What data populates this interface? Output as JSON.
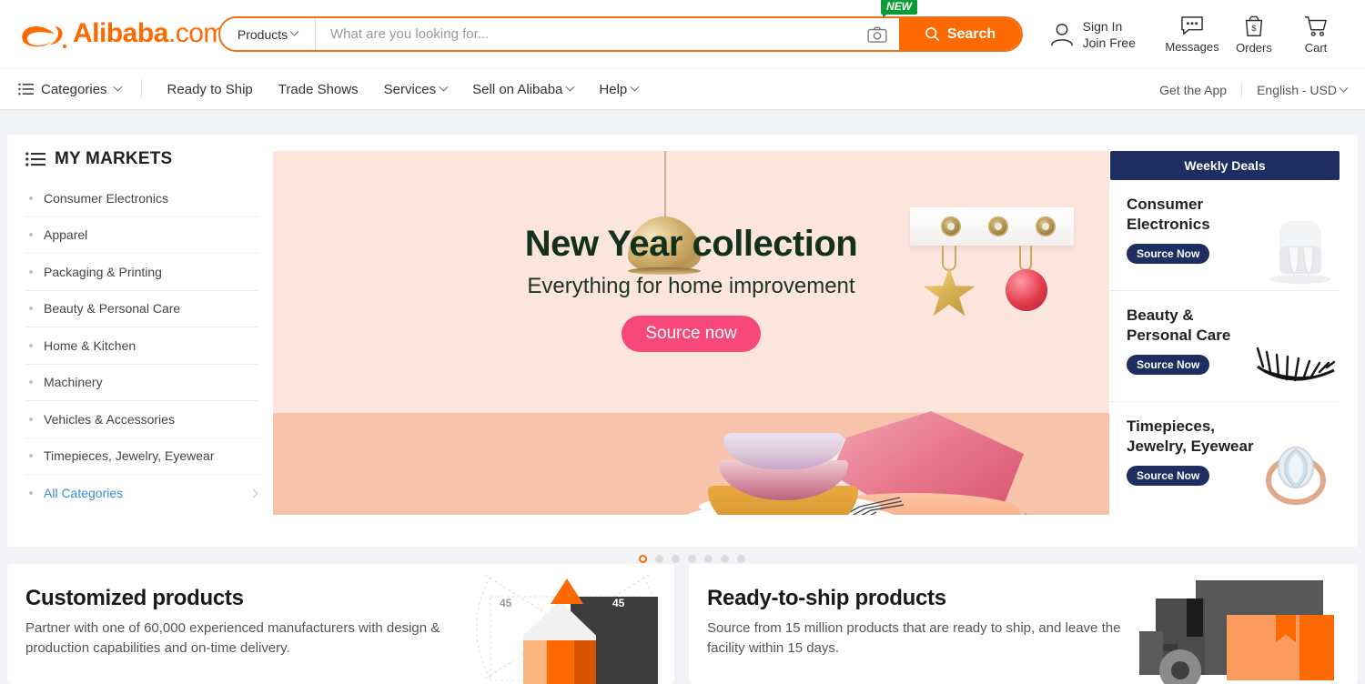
{
  "header": {
    "logo_text": "Alibaba",
    "logo_suffix": ".com",
    "search": {
      "category_label": "Products",
      "placeholder": "What are you looking for...",
      "value": "",
      "camera_badge": "NEW",
      "button_label": "Search"
    },
    "account": {
      "sign_in": "Sign In",
      "join_free": "Join Free"
    },
    "messages_label": "Messages",
    "orders_label": "Orders",
    "cart_label": "Cart"
  },
  "nav": {
    "categories_label": "Categories",
    "links": [
      {
        "label": "Ready to Ship",
        "caret": false
      },
      {
        "label": "Trade Shows",
        "caret": false
      },
      {
        "label": "Services",
        "caret": true
      },
      {
        "label": "Sell on Alibaba",
        "caret": true
      },
      {
        "label": "Help",
        "caret": true
      }
    ],
    "get_app": "Get the App",
    "locale": "English - USD"
  },
  "sidebar": {
    "title": "MY MARKETS",
    "items": [
      {
        "label": "Consumer Electronics"
      },
      {
        "label": "Apparel"
      },
      {
        "label": "Packaging & Printing"
      },
      {
        "label": "Beauty & Personal Care"
      },
      {
        "label": "Home & Kitchen"
      },
      {
        "label": "Machinery"
      },
      {
        "label": "Vehicles & Accessories"
      },
      {
        "label": "Timepieces, Jewelry, Eyewear"
      }
    ],
    "all_categories": "All Categories"
  },
  "hero": {
    "title": "New Year collection",
    "subtitle": "Everything for home improvement",
    "cta": "Source now",
    "slide_count": 7,
    "active_slide": 1
  },
  "deals": {
    "heading": "Weekly Deals",
    "items": [
      {
        "title": "Consumer Electronics",
        "button": "Source Now",
        "image": "earbuds-image"
      },
      {
        "title": "Beauty & Personal Care",
        "button": "Source Now",
        "image": "eyelashes-image"
      },
      {
        "title": "Timepieces, Jewelry, Eyewear",
        "button": "Source Now",
        "image": "diamond-ring-image"
      }
    ]
  },
  "promos": [
    {
      "title": "Customized products",
      "text": "Partner with one of 60,000 experienced manufacturers with design & production capabilities and on-time delivery.",
      "illustration": "pencil-blueprint-image",
      "angle_left": "45",
      "angle_right": "45"
    },
    {
      "title": "Ready-to-ship products",
      "text": "Source from 15 million products that are ready to ship, and leave the facility within 15 days.",
      "illustration": "delivery-truck-image"
    }
  ],
  "colors": {
    "brand_orange": "#ff6a00",
    "deals_navy": "#1f2e60",
    "cta_pink": "#f8487b",
    "new_badge_green": "#0c9c37",
    "link_blue": "#3c8cdb",
    "page_bg": "#f2f3f7"
  }
}
